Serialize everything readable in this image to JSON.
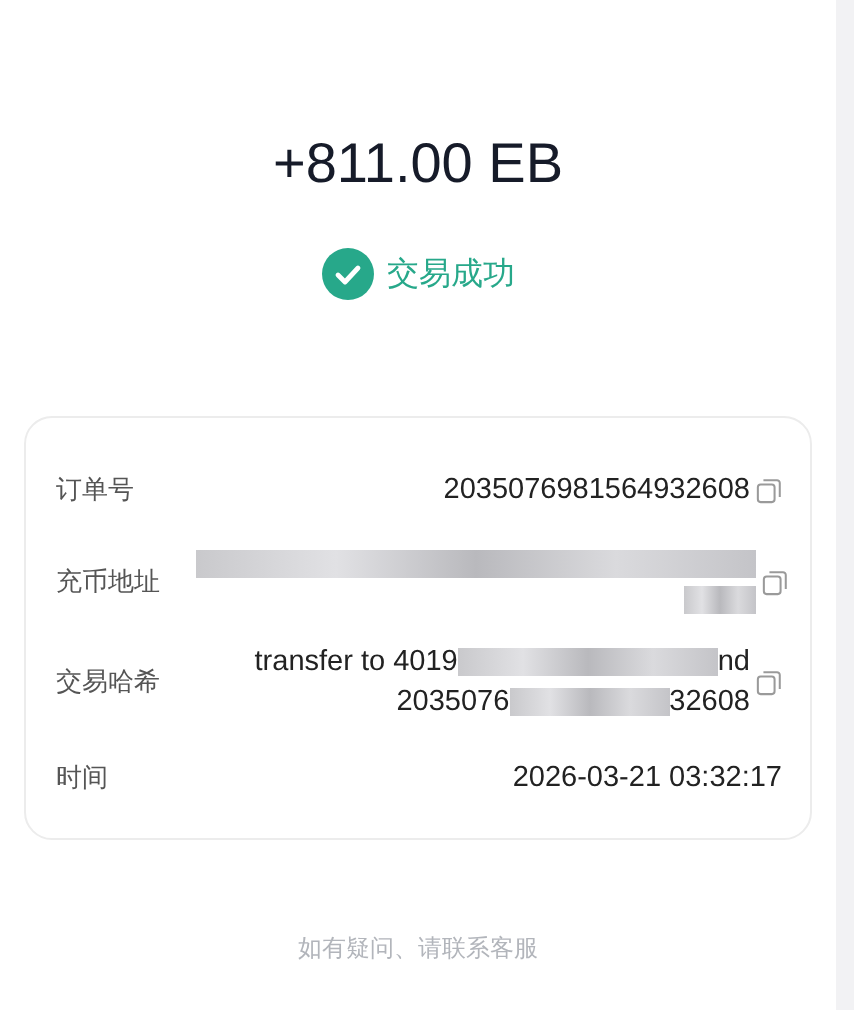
{
  "amount": "+811.00 EB",
  "status": {
    "kind": "success",
    "text": "交易成功"
  },
  "details": [
    {
      "label": "订单号",
      "copyable": true,
      "lines": [
        [
          {
            "kind": "text",
            "text": "2035076981564932608"
          }
        ]
      ]
    },
    {
      "label": "充币地址",
      "copyable": true,
      "lines": [
        [
          {
            "kind": "redacted"
          }
        ],
        [
          {
            "kind": "redacted"
          }
        ]
      ]
    },
    {
      "label": "交易哈希",
      "copyable": true,
      "lines": [
        [
          {
            "kind": "text",
            "text": "transfer to 4019"
          },
          {
            "kind": "redacted"
          },
          {
            "kind": "text",
            "text": "nd"
          }
        ],
        [
          {
            "kind": "text",
            "text": "2035076"
          },
          {
            "kind": "redacted"
          },
          {
            "kind": "text",
            "text": "32608"
          }
        ]
      ]
    },
    {
      "label": "时间",
      "copyable": false,
      "lines": [
        [
          {
            "kind": "text",
            "text": "2026-03-21 03:32:17"
          }
        ]
      ]
    }
  ],
  "help_link": "如有疑问、请联系客服"
}
